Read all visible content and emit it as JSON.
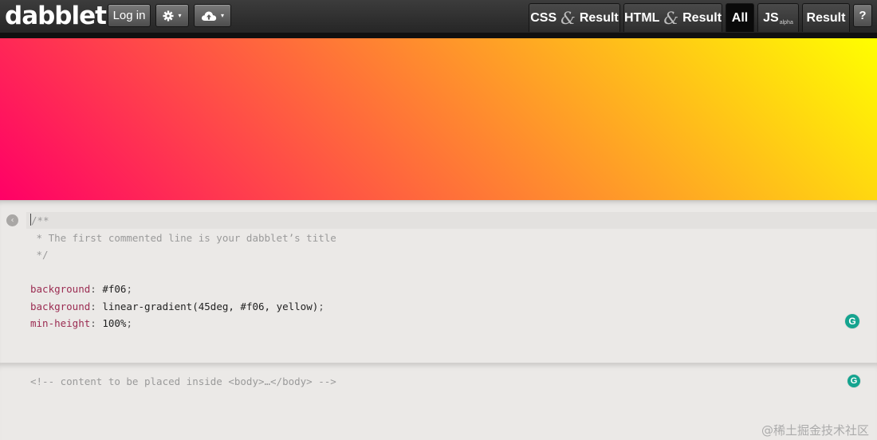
{
  "app": {
    "logo": "dabblet"
  },
  "toolbar": {
    "login_label": "Log in",
    "settings_icon": "gear-icon",
    "cloud_icon": "cloud-icon",
    "caret": "▾"
  },
  "tabs": {
    "css_result": {
      "first": "CSS",
      "amp": "&",
      "second": "Result"
    },
    "html_result": {
      "first": "HTML",
      "amp": "&",
      "second": "Result"
    },
    "all": "All",
    "js": "JS",
    "js_badge": "alpha",
    "result": "Result",
    "help": "?"
  },
  "result_preview": {
    "background_start": "#ff0066",
    "background_end": "#ffff00"
  },
  "css_editor": {
    "comment_open": "/**",
    "comment_line": " * The first commented line is your dabblet’s title",
    "comment_close": " */",
    "rules": [
      {
        "property": "background",
        "value": "#f06"
      },
      {
        "property": "background",
        "value": "linear-gradient(45deg, #f06, yellow)"
      },
      {
        "property": "min-height",
        "value": "100%"
      }
    ],
    "collapse_glyph": "‹"
  },
  "html_editor": {
    "placeholder": "<!-- content to be placed inside <body>…</body> -->"
  },
  "grammarly_badge": "G",
  "watermark": "@稀土掘金技术社区"
}
